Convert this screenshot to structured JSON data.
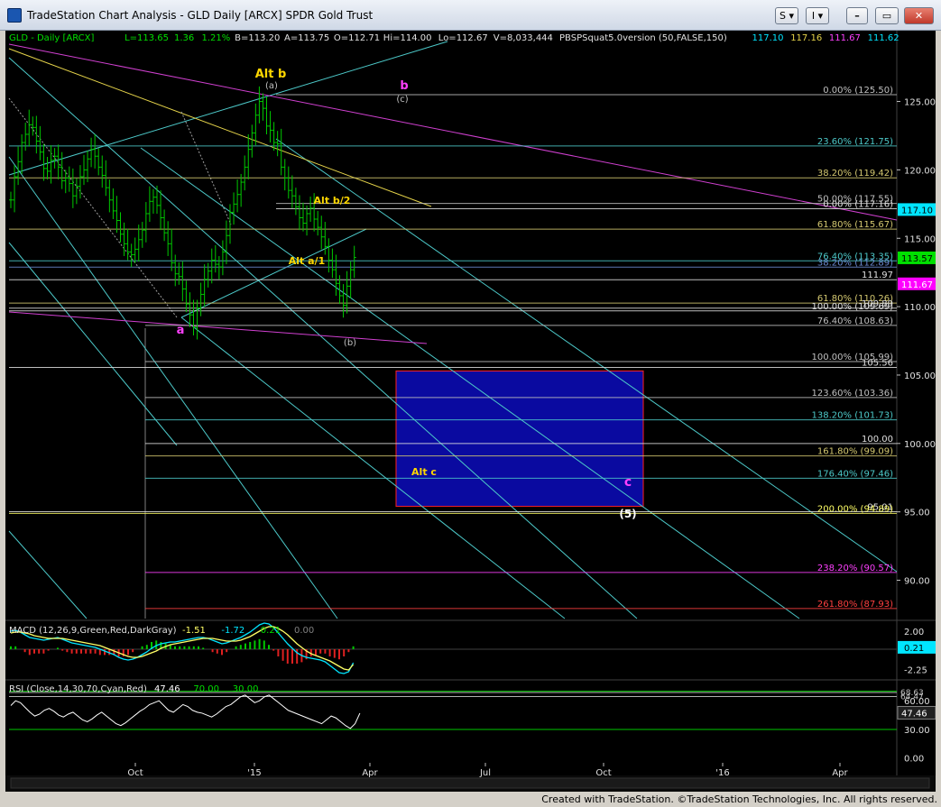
{
  "window": {
    "title": "TradeStation Chart Analysis - GLD Daily [ARCX] SPDR Gold Trust",
    "buttons": [
      "S",
      "I"
    ],
    "status": "Created with TradeStation. ©TradeStation Technologies, Inc. All rights reserved."
  },
  "chart_data": [
    {
      "type": "candlestick",
      "panel": "price",
      "header": {
        "symbol": "GLD - Daily",
        "exchange": "ARCX",
        "last": "L=113.65",
        "change": "1.36",
        "change_pct": "1.21%",
        "bid": "B=113.20",
        "ask": "A=113.75",
        "open": "O=112.71",
        "high": "Hi=114.00",
        "low": "Lo=112.67",
        "volume": "V=8,033,444",
        "study": "PBSPSquat5.0version (50,FALSE,150)",
        "study_values": [
          "117.10",
          "117.16",
          "111.67",
          "111.62"
        ]
      },
      "x_labels": [
        "Oct",
        "'15",
        "Apr",
        "Jul",
        "Oct",
        "'16",
        "Apr"
      ],
      "y_ticks": [
        125,
        120,
        115,
        110,
        105,
        100,
        95,
        90
      ],
      "ylim": [
        87.2,
        128.2
      ],
      "price_tags": [
        {
          "value": 117.1,
          "text": "117.10",
          "color": "#00e5ff",
          "text_color": "#000000"
        },
        {
          "value": 113.57,
          "text": "113.57",
          "color": "#00e000",
          "text_color": "#000000"
        },
        {
          "value": 111.67,
          "text": "111.67",
          "color": "#ff00ff",
          "text_color": "#ffffff"
        }
      ],
      "fib_levels": [
        {
          "value": 125.5,
          "text": "0.00% (125.50)",
          "color": "#c0c0c0"
        },
        {
          "value": 121.75,
          "text": "23.60% (121.75)",
          "color": "#4cc8c8"
        },
        {
          "value": 119.42,
          "text": "38.20% (119.42)",
          "color": "#d4c870"
        },
        {
          "value": 117.55,
          "text": "50.00% (117.55)",
          "color": "#c0c0c0"
        },
        {
          "value": 117.16,
          "text": "0.00% (117.16)",
          "color": "#e0e0e0"
        },
        {
          "value": 115.67,
          "text": "61.80% (115.67)",
          "color": "#d4c870"
        },
        {
          "value": 113.35,
          "text": "76.40% (113.35)",
          "color": "#4cc8c8"
        },
        {
          "value": 112.89,
          "text": "38.20% (112.89)",
          "color": "#6a8ad0"
        },
        {
          "value": 111.97,
          "text": "111.97",
          "color": "#e0e0e0"
        },
        {
          "value": 110.26,
          "text": "61.80% (110.26)",
          "color": "#d4c870"
        },
        {
          "value": 109.89,
          "text": "109.89",
          "color": "#e0e0e0"
        },
        {
          "value": 109.69,
          "text": "100.00% (109.69)",
          "color": "#e0e0e0"
        },
        {
          "value": 108.63,
          "text": "76.40% (108.63)",
          "color": "#c0c0c0"
        },
        {
          "value": 105.99,
          "text": "100.00% (105.99)",
          "color": "#c0c0c0"
        },
        {
          "value": 105.56,
          "text": "105.56",
          "color": "#e0e0e0"
        },
        {
          "value": 103.36,
          "text": "123.60% (103.36)",
          "color": "#c0c0c0"
        },
        {
          "value": 101.73,
          "text": "138.20% (101.73)",
          "color": "#4cc8c8"
        },
        {
          "value": 100.0,
          "text": "100.00",
          "color": "#e0e0e0"
        },
        {
          "value": 99.09,
          "text": "161.80% (99.09)",
          "color": "#d4c870"
        },
        {
          "value": 97.46,
          "text": "176.40% (97.46)",
          "color": "#4cc8c8"
        },
        {
          "value": 95.01,
          "text": "95.01",
          "color": "#e0e0e0"
        },
        {
          "value": 94.89,
          "text": "200.00% (94.89)",
          "color": "#ffff66"
        },
        {
          "value": 90.57,
          "text": "238.20% (90.57)",
          "color": "#ff40ff"
        },
        {
          "value": 87.93,
          "text": "261.80% (87.93)",
          "color": "#ff4040"
        }
      ],
      "wave_labels": [
        {
          "text": "Alt b",
          "color": "#ffd700"
        },
        {
          "text": "(a)",
          "color": "#c0c0c0"
        },
        {
          "text": "b",
          "color": "#ff40ff"
        },
        {
          "text": "(c)",
          "color": "#c0c0c0"
        },
        {
          "text": "Alt b/2",
          "color": "#ffd700"
        },
        {
          "text": "Alt a/1",
          "color": "#ffd700"
        },
        {
          "text": "a",
          "color": "#ff40ff"
        },
        {
          "text": "(b)",
          "color": "#c0c0c0"
        },
        {
          "text": "Alt c",
          "color": "#ffd700"
        },
        {
          "text": "c",
          "color": "#ff40ff"
        },
        {
          "text": "(5)",
          "color": "#ffffff"
        }
      ],
      "target_box": {
        "y_high": 105.3,
        "y_low": 95.4,
        "fill": "#0a0aa0",
        "stroke": "#ff2020"
      },
      "price_series": [
        117.8,
        119.5,
        120.6,
        122.0,
        122.6,
        123.3,
        123.1,
        122.1,
        121.3,
        120.1,
        119.9,
        120.7,
        121.0,
        120.2,
        119.2,
        119.4,
        119.0,
        118.1,
        118.8,
        119.5,
        120.0,
        120.8,
        121.5,
        121.0,
        120.2,
        119.6,
        118.7,
        117.8,
        117.0,
        116.3,
        115.3,
        114.6,
        114.0,
        113.8,
        114.2,
        114.9,
        115.6,
        116.8,
        117.7,
        118.0,
        117.4,
        116.5,
        115.4,
        114.6,
        113.2,
        112.4,
        112.2,
        111.3,
        110.2,
        109.4,
        108.5,
        109.9,
        110.9,
        112.0,
        112.6,
        113.4,
        113.1,
        112.9,
        114.0,
        115.2,
        116.9,
        117.5,
        118.2,
        119.1,
        120.2,
        121.5,
        122.7,
        124.0,
        125.0,
        124.5,
        123.2,
        122.9,
        122.0,
        121.9,
        120.2,
        119.4,
        118.5,
        118.1,
        117.3,
        116.5,
        116.1,
        116.8,
        117.2,
        116.4,
        115.8,
        115.1,
        114.4,
        113.4,
        112.7,
        111.7,
        110.8,
        110.1,
        111.5,
        112.7,
        113.6
      ]
    },
    {
      "type": "line",
      "panel": "macd",
      "header": {
        "name": "MACD (12,26,9,Green,Red,DarkGray)",
        "values": [
          "-1.51",
          "-1.72",
          "0.21",
          "0.00"
        ]
      },
      "y_ticks": [
        2.0,
        -2.25
      ],
      "ylim": [
        -3.2,
        3.0
      ],
      "value_tag": {
        "value": 0.21,
        "text": "0.21",
        "color": "#00e5ff"
      },
      "macd_series": [
        2.0,
        2.1,
        1.9,
        1.6,
        1.3,
        1.2,
        1.1,
        1.0,
        1.1,
        1.2,
        1.3,
        1.1,
        0.9,
        0.7,
        0.6,
        0.5,
        0.4,
        0.3,
        0.2,
        0.0,
        -0.2,
        -0.4,
        -0.6,
        -0.9,
        -1.1,
        -1.2,
        -1.1,
        -0.9,
        -0.6,
        -0.3,
        0.1,
        0.4,
        0.6,
        0.7,
        0.8,
        0.8,
        0.9,
        1.0,
        1.1,
        1.2,
        1.3,
        1.3,
        1.2,
        1.0,
        0.8,
        0.6,
        0.7,
        0.9,
        1.1,
        1.3,
        1.6,
        1.9,
        2.3,
        2.7,
        2.9,
        2.8,
        2.4,
        1.8,
        1.2,
        0.6,
        0.1,
        -0.4,
        -0.7,
        -0.9,
        -1.0,
        -1.1,
        -1.2,
        -1.4,
        -1.8,
        -2.2,
        -2.6,
        -2.7,
        -2.5,
        -1.5
      ],
      "signal_series": [
        1.8,
        1.9,
        1.9,
        1.8,
        1.7,
        1.5,
        1.4,
        1.3,
        1.2,
        1.2,
        1.2,
        1.2,
        1.1,
        1.0,
        0.9,
        0.8,
        0.7,
        0.6,
        0.5,
        0.4,
        0.2,
        0.0,
        -0.2,
        -0.4,
        -0.6,
        -0.8,
        -0.9,
        -0.9,
        -0.8,
        -0.6,
        -0.4,
        -0.2,
        0.1,
        0.3,
        0.5,
        0.6,
        0.7,
        0.8,
        0.9,
        1.0,
        1.1,
        1.2,
        1.2,
        1.2,
        1.1,
        1.0,
        0.9,
        0.9,
        0.9,
        1.0,
        1.2,
        1.4,
        1.7,
        2.0,
        2.3,
        2.5,
        2.5,
        2.3,
        2.0,
        1.6,
        1.1,
        0.6,
        0.2,
        -0.2,
        -0.5,
        -0.7,
        -0.9,
        -1.1,
        -1.3,
        -1.6,
        -1.9,
        -2.2,
        -2.3,
        -1.7
      ]
    },
    {
      "type": "line",
      "panel": "rsi",
      "header": {
        "name": "RSI (Close,14,30,70,Cyan,Red)",
        "values": [
          "47.46",
          "70.00",
          "30.00"
        ]
      },
      "y_ticks": [
        60.0,
        30.0,
        0.0
      ],
      "tick_labels": [
        "60.00",
        "30.00",
        "0.00"
      ],
      "overbought_lines": [
        {
          "value": 68.63,
          "text": "68.63"
        },
        {
          "value": 64.47,
          "text": "64.47"
        }
      ],
      "ylim": [
        -5,
        80
      ],
      "value_tag": {
        "value": 47.46,
        "text": "47.46",
        "color": "#ffffff"
      },
      "rsi_series": [
        55,
        60,
        58,
        53,
        48,
        44,
        46,
        50,
        52,
        49,
        45,
        43,
        46,
        48,
        44,
        40,
        38,
        41,
        45,
        48,
        44,
        40,
        36,
        34,
        37,
        41,
        45,
        49,
        52,
        56,
        58,
        60,
        55,
        50,
        48,
        52,
        56,
        54,
        50,
        48,
        47,
        45,
        43,
        46,
        50,
        54,
        56,
        60,
        64,
        66,
        62,
        58,
        60,
        64,
        66,
        62,
        58,
        54,
        50,
        48,
        46,
        44,
        42,
        40,
        38,
        36,
        40,
        44,
        42,
        38,
        34,
        31,
        36,
        47
      ]
    }
  ]
}
